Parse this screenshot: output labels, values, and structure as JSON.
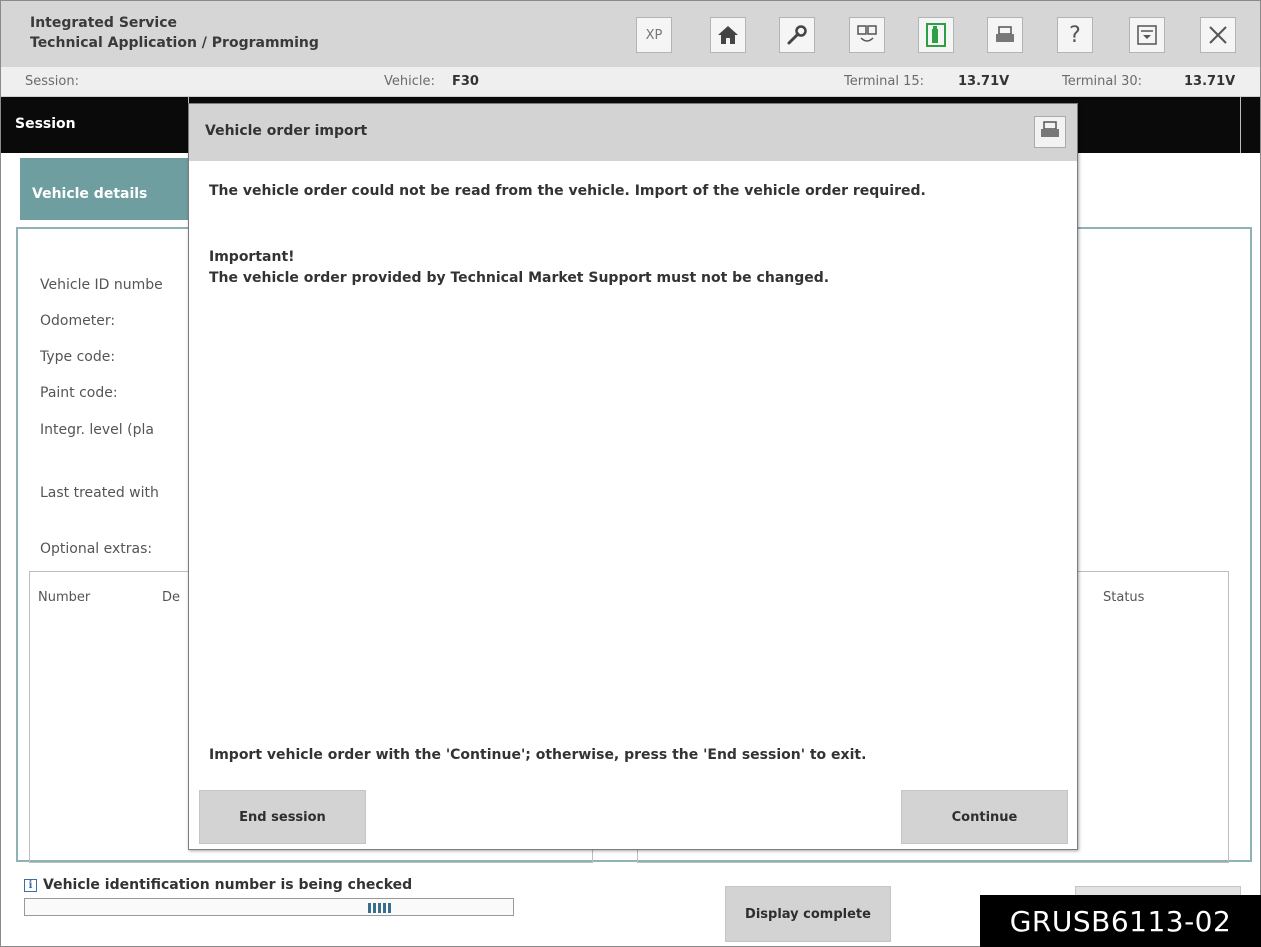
{
  "app": {
    "title_line1": "Integrated Service",
    "title_line2": "Technical Application / Programming"
  },
  "toolbar": {
    "items": [
      {
        "name": "xp",
        "label": "XP"
      },
      {
        "name": "home-icon"
      },
      {
        "name": "wrench-icon"
      },
      {
        "name": "diagnostics-icon"
      },
      {
        "name": "battery-icon"
      },
      {
        "name": "print-icon"
      },
      {
        "name": "help-icon",
        "label": "?"
      },
      {
        "name": "minimize-icon"
      },
      {
        "name": "close-icon"
      }
    ]
  },
  "session_bar": {
    "session_label": "Session:",
    "vehicle_label": "Vehicle:",
    "vehicle_value": "F30",
    "terminal15_label": "Terminal 15:",
    "terminal15_value": "13.71V",
    "terminal30_label": "Terminal 30:",
    "terminal30_value": "13.71V"
  },
  "tabs": {
    "session_tab": "Session",
    "vehicle_details_tab": "Vehicle details"
  },
  "vehicle_fields": {
    "vin": "Vehicle ID numbe",
    "odometer": "Odometer:",
    "type_code": "Type code:",
    "paint_code": "Paint code:",
    "integr_level": "Integr. level (pla",
    "last_treated": "Last treated with",
    "optional_extras": "Optional extras:"
  },
  "extras_table": {
    "col_number": "Number",
    "col_desc": "De",
    "col_status": "Status"
  },
  "status": {
    "message": "Vehicle identification number is being checked",
    "display_complete": "Display complete"
  },
  "dialog": {
    "title": "Vehicle order import",
    "message1": "The vehicle order could not be read from the vehicle. Import of the vehicle order required.",
    "important_heading": "Important!",
    "important_text": "The vehicle order provided by Technical Market Support must not be changed.",
    "instruction": "Import vehicle order with the 'Continue'; otherwise, press the 'End session' to exit.",
    "end_session_label": "End session",
    "continue_label": "Continue"
  },
  "watermark": "GRUSB6113-02",
  "colors": {
    "accent_teal": "#6f9ea1",
    "tab_bar": "#0a0a0a",
    "battery_green": "#2ea043"
  }
}
